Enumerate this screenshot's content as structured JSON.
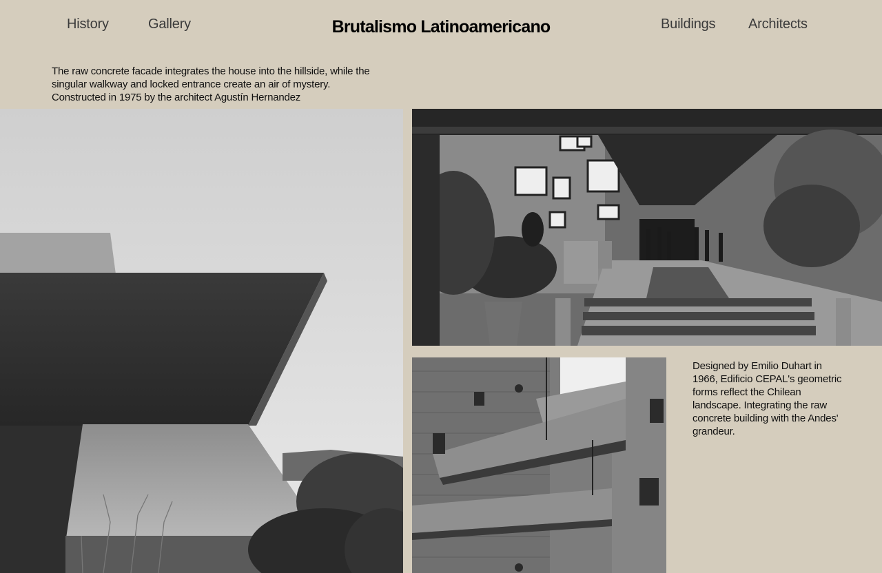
{
  "nav": {
    "history": "History",
    "gallery": "Gallery",
    "buildings": "Buildings",
    "architects": "Architects"
  },
  "site": {
    "title": "Brutalismo Latinoamericano"
  },
  "captions": {
    "house": "The raw concrete facade integrates the house into the hillside, while the singular walkway and locked entrance create an air of mystery. Constructed in 1975 by the architect Agustín Hernandez",
    "cepal": "Designed by Emilio Duhart in 1966, Edificio CEPAL's geometric forms reflect the Chilean landscape.  Integrating the raw concrete building with the Andes' grandeur."
  },
  "colors": {
    "background": "#d5cdbd",
    "title": "#000000",
    "nav": "#3a3a3a"
  }
}
